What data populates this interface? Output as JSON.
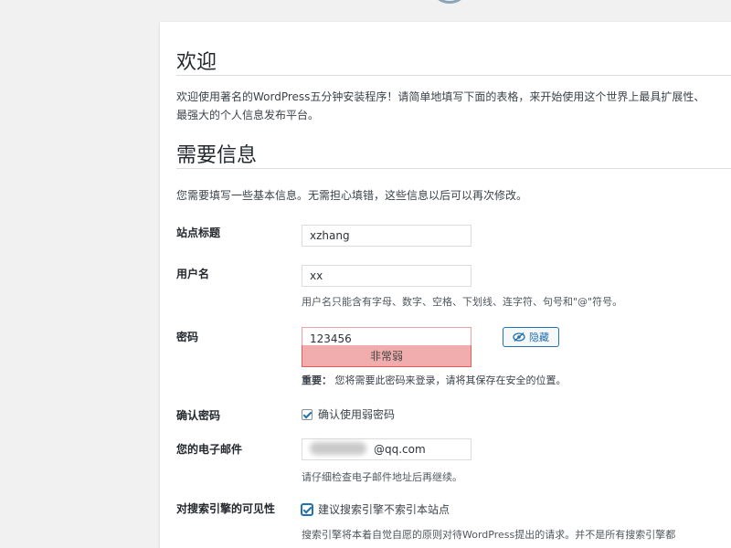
{
  "welcome": {
    "heading": "欢迎",
    "text": "欢迎使用著名的WordPress五分钟安装程序！请简单地填写下面的表格，来开始使用这个世界上最具扩展性、最强大的个人信息发布平台。"
  },
  "info": {
    "heading": "需要信息",
    "intro": "您需要填写一些基本信息。无需担心填错，这些信息以后可以再次修改。"
  },
  "fields": {
    "site_title": {
      "label": "站点标题",
      "value": "xzhang"
    },
    "username": {
      "label": "用户名",
      "value": "xx",
      "hint": "用户名只能含有字母、数字、空格、下划线、连字符、句号和\"@\"符号。"
    },
    "password": {
      "label": "密码",
      "value": "123456",
      "strength": "非常弱",
      "hide_label": "隐藏",
      "note_bold": "重要：",
      "note": "您将需要此密码来登录，请将其保存在安全的位置。"
    },
    "confirm": {
      "label": "确认密码",
      "checkbox_label": "确认使用弱密码",
      "checked": true
    },
    "email": {
      "label": "您的电子邮件",
      "value": "@qq.com",
      "hint": "请仔细检查电子邮件地址后再继续。"
    },
    "visibility": {
      "label": "对搜索引擎的可见性",
      "checkbox_label": "建议搜索引擎不索引本站点",
      "checked": true,
      "hint": "搜索引擎将本着自觉自愿的原则对待WordPress提出的请求。并不是所有搜索引擎都"
    }
  },
  "colors": {
    "accent": "#2271b1",
    "weak_bg": "#f1adad",
    "weak_border": "#e35b5b"
  },
  "icons": {
    "hide": "eye-slash-icon"
  }
}
